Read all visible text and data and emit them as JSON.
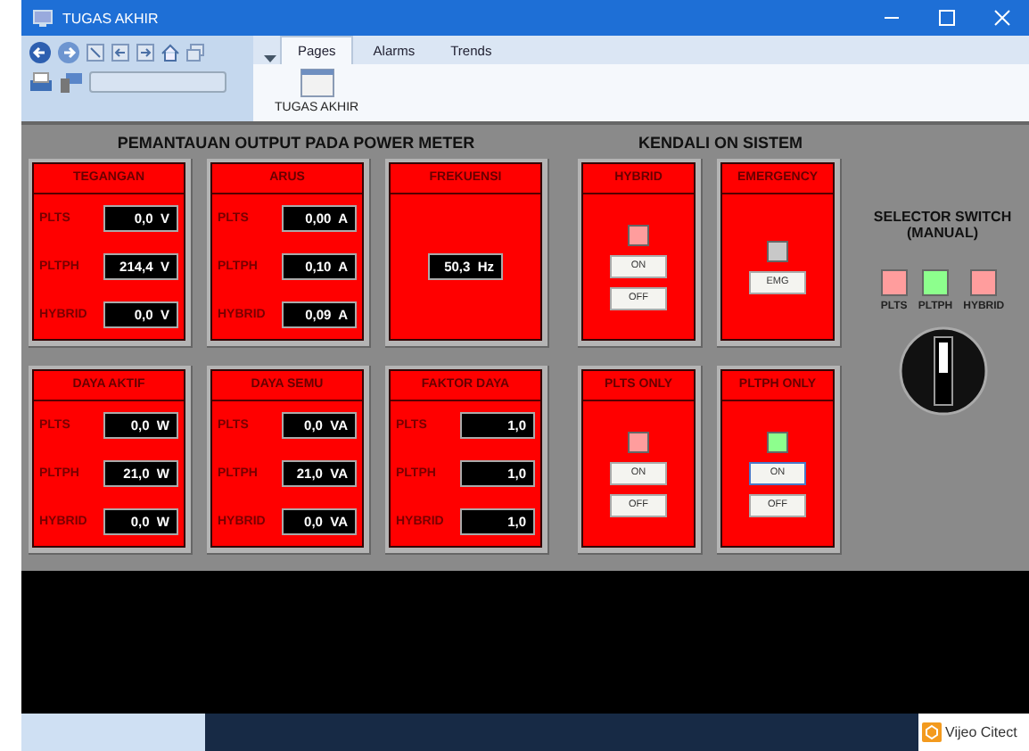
{
  "window": {
    "title": "TUGAS AKHIR"
  },
  "ribbon": {
    "tabs": [
      {
        "label": "Pages",
        "selected": true
      },
      {
        "label": "Alarms",
        "selected": false
      },
      {
        "label": "Trends",
        "selected": false
      }
    ],
    "page_button": "TUGAS AKHIR"
  },
  "monitor": {
    "title": "PEMANTAUAN OUTPUT PADA POWER METER",
    "cards": [
      {
        "title": "TEGANGAN",
        "kind": "list",
        "rows": [
          {
            "label": "PLTS",
            "value": "0,0  V"
          },
          {
            "label": "PLTPH",
            "value": "214,4  V"
          },
          {
            "label": "HYBRID",
            "value": "0,0  V"
          }
        ]
      },
      {
        "title": "ARUS",
        "kind": "list",
        "rows": [
          {
            "label": "PLTS",
            "value": "0,00  A"
          },
          {
            "label": "PLTPH",
            "value": "0,10  A"
          },
          {
            "label": "HYBRID",
            "value": "0,09  A"
          }
        ]
      },
      {
        "title": "FREKUENSI",
        "kind": "single",
        "value": "50,3  Hz"
      },
      {
        "title": "DAYA AKTIF",
        "kind": "list",
        "rows": [
          {
            "label": "PLTS",
            "value": "0,0  W"
          },
          {
            "label": "PLTPH",
            "value": "21,0  W"
          },
          {
            "label": "HYBRID",
            "value": "0,0  W"
          }
        ]
      },
      {
        "title": "DAYA SEMU",
        "kind": "list",
        "rows": [
          {
            "label": "PLTS",
            "value": "0,0  VA"
          },
          {
            "label": "PLTPH",
            "value": "21,0  VA"
          },
          {
            "label": "HYBRID",
            "value": "0,0  VA"
          }
        ]
      },
      {
        "title": "FAKTOR DAYA",
        "kind": "list",
        "rows": [
          {
            "label": "PLTS",
            "value": "1,0"
          },
          {
            "label": "PLTPH",
            "value": "1,0"
          },
          {
            "label": "HYBRID",
            "value": "1,0"
          }
        ]
      }
    ]
  },
  "control": {
    "title": "KENDALI ON SISTEM",
    "cards": [
      {
        "title": "HYBRID",
        "color": "#ff9d9d",
        "buttons": [
          {
            "label": "ON",
            "focused": false
          },
          {
            "label": "OFF",
            "focused": false
          }
        ]
      },
      {
        "title": "EMERGENCY",
        "color": "#c8c8c8",
        "buttons": [
          {
            "label": "EMG",
            "focused": false
          }
        ]
      },
      {
        "title": "PLTS ONLY",
        "color": "#ff9d9d",
        "buttons": [
          {
            "label": "ON",
            "focused": false
          },
          {
            "label": "OFF",
            "focused": false
          }
        ]
      },
      {
        "title": "PLTPH ONLY",
        "color": "#8dff8d",
        "buttons": [
          {
            "label": "ON",
            "focused": true
          },
          {
            "label": "OFF",
            "focused": false
          }
        ]
      }
    ]
  },
  "selector": {
    "title": "SELECTOR SWITCH\n(MANUAL)",
    "lamps": [
      {
        "label": "PLTS",
        "color": "#ff9d9d"
      },
      {
        "label": "PLTPH",
        "color": "#8dff8d"
      },
      {
        "label": "HYBRID",
        "color": "#ff9d9d"
      }
    ]
  },
  "taskbar": {
    "brand": "Vijeo Citect"
  }
}
